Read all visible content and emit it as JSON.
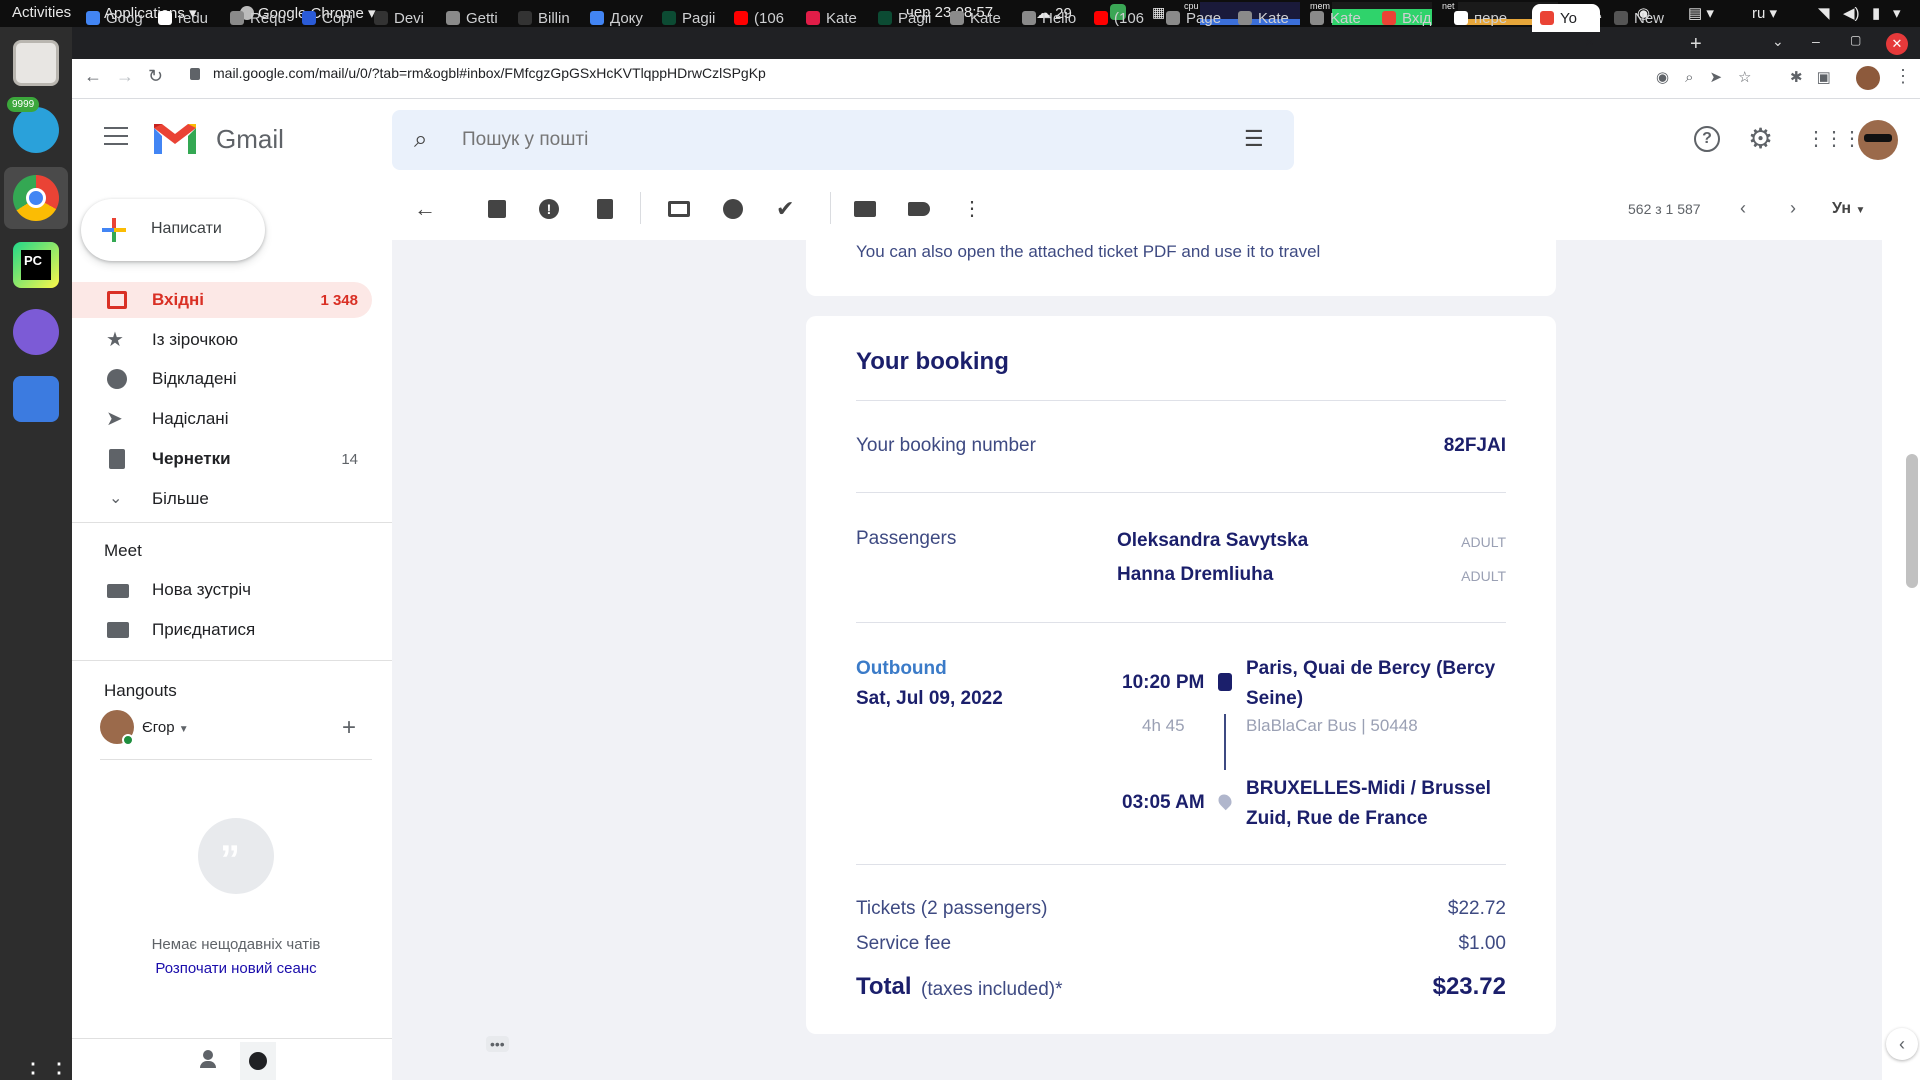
{
  "os": {
    "activities": "Activities",
    "applications": "Applications",
    "app_name": "Google Chrome",
    "datetime": "чер 23  08:57",
    "temp": "29",
    "cpu_label": "cpu",
    "mem_label": "mem",
    "net_label": "net",
    "lang": "ru",
    "telegram_badge": "9999"
  },
  "browser": {
    "tabs": [
      {
        "label": "Goog",
        "color": "#4285f4"
      },
      {
        "label": "redu",
        "color": "#ffffff"
      },
      {
        "label": "Requ",
        "color": "#8a8a8a"
      },
      {
        "label": "Copi",
        "color": "#2a5bd7"
      },
      {
        "label": "Devi",
        "color": "#333333"
      },
      {
        "label": "Getti",
        "color": "#8a8a8a"
      },
      {
        "label": "Billin",
        "color": "#333333"
      },
      {
        "label": "Доку",
        "color": "#4285f4"
      },
      {
        "label": "Pagii",
        "color": "#0c4b33"
      },
      {
        "label": "(106",
        "color": "#ff0000"
      },
      {
        "label": "Kate",
        "color": "#e11d48"
      },
      {
        "label": "Pagii",
        "color": "#0c4b33"
      },
      {
        "label": "Kate",
        "color": "#8a8a8a"
      },
      {
        "label": "Hello",
        "color": "#8a8a8a"
      },
      {
        "label": "(106",
        "color": "#ff0000"
      },
      {
        "label": "Page",
        "color": "#8a8a8a"
      },
      {
        "label": "Kate",
        "color": "#8a8a8a"
      },
      {
        "label": "Kate",
        "color": "#8a8a8a"
      },
      {
        "label": "Вхід",
        "color": "#ea4335"
      },
      {
        "label": "пере",
        "color": "#ffffff"
      },
      {
        "label": "Yo",
        "color": "#ea4335"
      },
      {
        "label": "New",
        "color": "#555555"
      }
    ],
    "url": "mail.google.com/mail/u/0/?tab=rm&ogbl#inbox/FMfcgzGpGSxHcKVTlqppHDrwCzlSPgKp"
  },
  "gmail": {
    "brand": "Gmail",
    "search_placeholder": "Пошук у пошті",
    "compose": "Написати",
    "nav": [
      {
        "label": "Вхідні",
        "count": "1 348",
        "icon": "inbox-icon",
        "active": true
      },
      {
        "label": "Із зірочкою",
        "count": "",
        "icon": "star-icon"
      },
      {
        "label": "Відкладені",
        "count": "",
        "icon": "clock-icon"
      },
      {
        "label": "Надіслані",
        "count": "",
        "icon": "send-icon"
      },
      {
        "label": "Чернетки",
        "count": "14",
        "icon": "draft-icon",
        "bold": true
      },
      {
        "label": "Більше",
        "count": "",
        "icon": "chevron-down-icon"
      }
    ],
    "meet": {
      "title": "Meet",
      "new_meeting": "Нова зустріч",
      "join": "Приєднатися"
    },
    "hangouts": {
      "title": "Hangouts",
      "user": "Єгор",
      "empty": "Немає нещодавніх чатів",
      "start_new": "Розпочати новий сеанс"
    },
    "pager": "562 з 1 587",
    "input_lang": "Ун"
  },
  "email": {
    "top_note": "You can also open the attached ticket PDF and use it to travel",
    "booking_title": "Your booking",
    "booking_number_label": "Your booking number",
    "booking_number": "82FJAI",
    "passengers_label": "Passengers",
    "passengers": [
      {
        "name": "Oleksandra Savytska",
        "type": "ADULT"
      },
      {
        "name": "Hanna Dremliuha",
        "type": "ADULT"
      }
    ],
    "outbound_label": "Outbound",
    "outbound_date": "Sat, Jul 09, 2022",
    "depart_time": "10:20 PM",
    "depart_place_1": "Paris, Quai de Bercy (Bercy",
    "depart_place_2": "Seine)",
    "duration": "4h 45",
    "carrier": "BlaBlaCar Bus | 50448",
    "arrive_time": "03:05 AM",
    "arrive_place_1": "BRUXELLES-Midi / Brussel",
    "arrive_place_2": "Zuid, Rue de France",
    "tickets_label": "Tickets (2 passengers)",
    "tickets_price": "$22.72",
    "fee_label": "Service fee",
    "fee_price": "$1.00",
    "total_label": "Total",
    "total_note": "(taxes included)*",
    "total_price": "$23.72"
  },
  "colors": {
    "gmail_red": "#d93025",
    "navy": "#1b1f6b",
    "accent_blue": "#3b7bc8",
    "inbox_bg": "#fce8e6"
  }
}
